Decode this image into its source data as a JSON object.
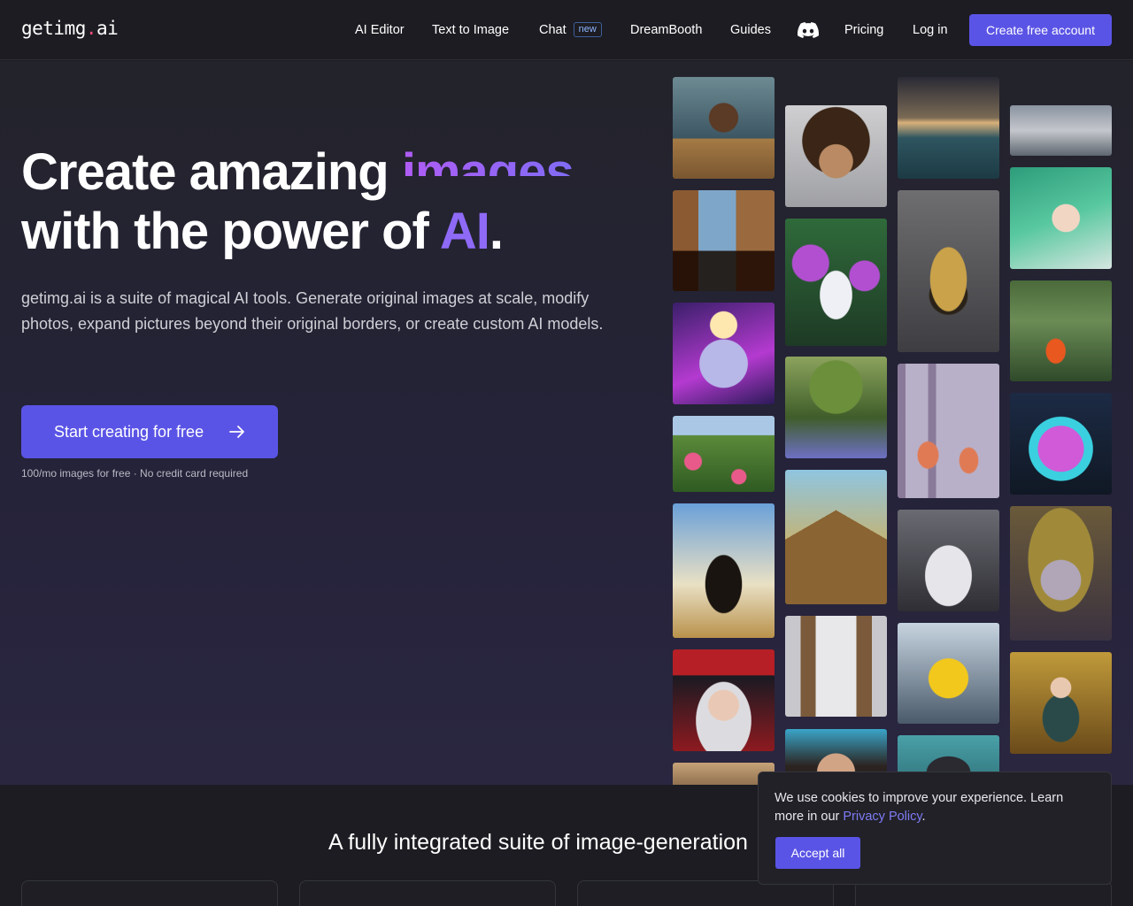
{
  "header": {
    "logo_prefix": "getimg",
    "logo_dot": ".",
    "logo_suffix": "ai",
    "nav": [
      {
        "label": "AI Editor"
      },
      {
        "label": "Text to Image"
      },
      {
        "label": "Chat",
        "badge": "new"
      },
      {
        "label": "DreamBooth"
      },
      {
        "label": "Guides"
      },
      {
        "label": "Pricing"
      },
      {
        "label": "Log in"
      }
    ],
    "discord_icon": "discord-icon",
    "cta_label": "Create free account"
  },
  "hero": {
    "title_part1": "Create amazing",
    "title_animated": "images",
    "title_part2": "with the power of",
    "title_ai": "AI",
    "title_end": ".",
    "lead": "getimg.ai is a suite of magical AI tools. Generate original images at scale, modify photos, expand pictures beyond their original borders, or create custom AI models.",
    "start_label": "Start creating for free",
    "start_icon": "arrow-right-icon",
    "subnote": "100/mo images for free · No credit card required"
  },
  "gallery": {
    "tiles": [
      {
        "name": "portrait-man-coat"
      },
      {
        "name": "curly-hair-man"
      },
      {
        "name": "stormy-ocean"
      },
      {
        "name": "clouds"
      },
      {
        "name": "bedroom-forest-view"
      },
      {
        "name": "woman-flowers-dress"
      },
      {
        "name": "golden-skull-ornament"
      },
      {
        "name": "green-hair-anime-girl"
      },
      {
        "name": "cosmic-cat"
      },
      {
        "name": "koi-pond"
      },
      {
        "name": "tree-sunlight"
      },
      {
        "name": "mushroom-forest"
      },
      {
        "name": "neon-hamster"
      },
      {
        "name": "rose-garden"
      },
      {
        "name": "pyramid-temple"
      },
      {
        "name": "glowing-sneaker"
      },
      {
        "name": "rider-on-horse"
      },
      {
        "name": "venetian-mask-woman"
      },
      {
        "name": "cathedral-interior"
      },
      {
        "name": "pikachu"
      },
      {
        "name": "santa-hat-woman"
      },
      {
        "name": "fantasy-girl-golden-hall"
      },
      {
        "name": "woman-portrait-sea"
      },
      {
        "name": "hat-still-life"
      },
      {
        "name": "mountain-landscape"
      }
    ]
  },
  "features": {
    "title": "A fully integrated suite of image-generation"
  },
  "cookie": {
    "text": "We use cookies to improve your experience. Learn more in our",
    "link": "Privacy Policy",
    "end": ".",
    "accept_label": "Accept all"
  },
  "colors": {
    "accent": "#5a54e6",
    "background": "#1c1c22",
    "gradient_text": "#b05cf5",
    "logo_dot": "#ef4c7a"
  }
}
